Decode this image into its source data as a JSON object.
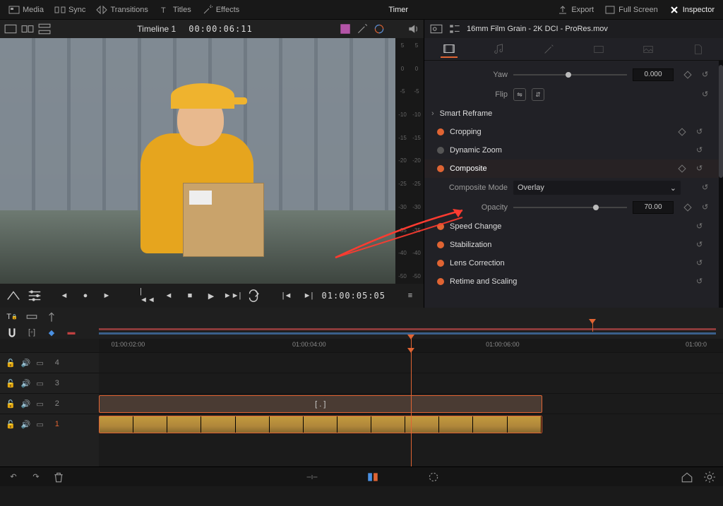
{
  "top": {
    "media": "Media",
    "sync": "Sync",
    "transitions": "Transitions",
    "titles": "Titles",
    "effects": "Effects",
    "timer": "Timer",
    "export": "Export",
    "fullscreen": "Full Screen",
    "inspector": "Inspector"
  },
  "viewer": {
    "timeline_name": "Timeline 1",
    "timecode": "00:00:06:11",
    "ruler": [
      "5",
      "0",
      "-5",
      "-10",
      "-15",
      "-20",
      "-25",
      "-30",
      "-35",
      "-40",
      "-50"
    ]
  },
  "transport": {
    "tc": "01:00:05:05"
  },
  "inspector": {
    "clip_name": "16mm Film Grain - 2K DCI - ProRes.mov",
    "yaw_label": "Yaw",
    "yaw_value": "0.000",
    "flip_label": "Flip",
    "smart_reframe": "Smart Reframe",
    "cropping": "Cropping",
    "dynamic_zoom": "Dynamic Zoom",
    "composite": "Composite",
    "composite_mode_label": "Composite Mode",
    "composite_mode_value": "Overlay",
    "opacity_label": "Opacity",
    "opacity_value": "70.00",
    "speed_change": "Speed Change",
    "stabilization": "Stabilization",
    "lens_correction": "Lens Correction",
    "retime": "Retime and Scaling"
  },
  "timeline": {
    "ticks": [
      "01:00:02:00",
      "01:00:04:00",
      "01:00:06:00",
      "01:00:0"
    ],
    "tracks": [
      {
        "num": "4"
      },
      {
        "num": "3"
      },
      {
        "num": "2"
      },
      {
        "num": "1"
      }
    ],
    "clip_marker": "[ . ]"
  }
}
